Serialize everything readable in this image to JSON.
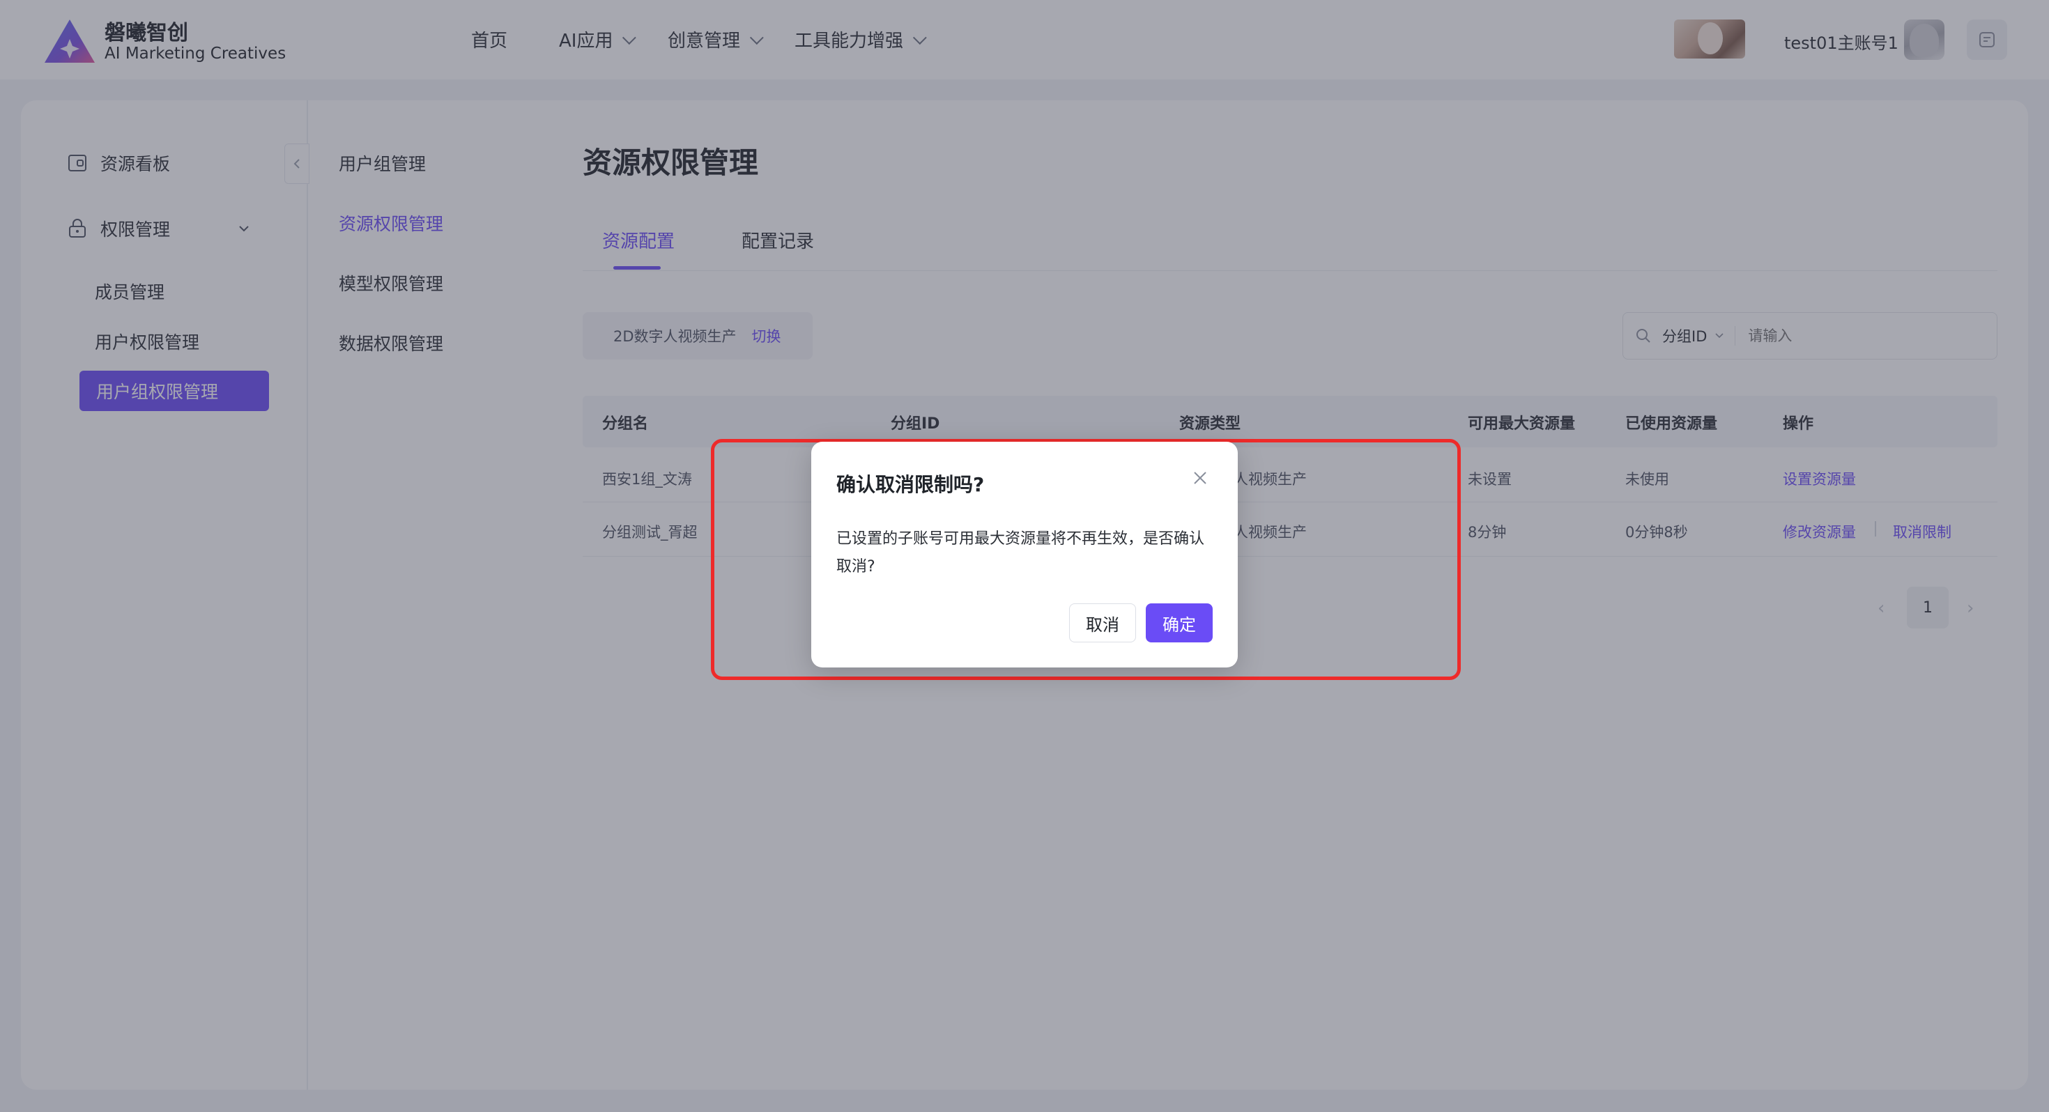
{
  "brand": {
    "name": "磐曦智创",
    "subtitle": "AI Marketing Creatives"
  },
  "nav": [
    {
      "label": "首页",
      "dropdown": false
    },
    {
      "label": "AI应用",
      "dropdown": true
    },
    {
      "label": "创意管理",
      "dropdown": true
    },
    {
      "label": "工具能力增强",
      "dropdown": true
    }
  ],
  "user": {
    "name": "test01主账号1"
  },
  "sidebar": {
    "items": [
      {
        "label": "资源看板",
        "icon": "dashboard-icon"
      },
      {
        "label": "权限管理",
        "icon": "lock-icon",
        "expanded": true
      }
    ],
    "sub_items": [
      {
        "label": "成员管理"
      },
      {
        "label": "用户权限管理"
      },
      {
        "label": "用户组权限管理",
        "active": true
      }
    ]
  },
  "subnav": [
    {
      "label": "用户组管理"
    },
    {
      "label": "资源权限管理",
      "active": true
    },
    {
      "label": "模型权限管理"
    },
    {
      "label": "数据权限管理"
    }
  ],
  "page": {
    "title": "资源权限管理",
    "tabs": [
      {
        "label": "资源配置",
        "active": true
      },
      {
        "label": "配置记录"
      }
    ]
  },
  "filter": {
    "resource": "2D数字人视频生产",
    "switch_label": "切换",
    "search_field": "分组ID",
    "search_placeholder": "请输入"
  },
  "table": {
    "columns": [
      "分组名",
      "分组ID",
      "资源类型",
      "可用最大资源量",
      "已使用资源量",
      "操作"
    ],
    "rows": [
      {
        "group": "西安1组_文涛",
        "resource_type": "人视频生产",
        "max": "未设置",
        "used": "未使用",
        "actions": [
          "设置资源量"
        ]
      },
      {
        "group": "分组测试_胥超",
        "resource_type": "人视频生产",
        "max": "8分钟",
        "used": "0分钟8秒",
        "actions": [
          "修改资源量",
          "取消限制"
        ]
      }
    ]
  },
  "pagination": {
    "current": "1"
  },
  "modal": {
    "title": "确认取消限制吗?",
    "body": "已设置的子账号可用最大资源量将不再生效，是否确认取消?",
    "cancel_label": "取消",
    "ok_label": "确定"
  },
  "colors": {
    "accent": "#6a4cf6",
    "highlight_border": "#ee2a2a"
  }
}
